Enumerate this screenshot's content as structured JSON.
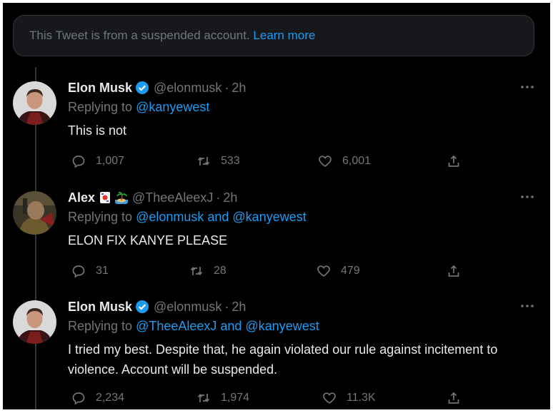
{
  "notice": {
    "text": "This Tweet is from a suspended account. ",
    "link": "Learn more"
  },
  "tweets": [
    {
      "name": "Elon Musk",
      "verified": true,
      "handle": "@elonmusk",
      "time": "2h",
      "replying_label": "Replying to ",
      "replying_to": "@kanyewest",
      "text": "This is not",
      "replies": "1,007",
      "retweets": "533",
      "likes": "6,001"
    },
    {
      "name": "Alex",
      "emojis": [
        "joker-card-emoji",
        "desert-island-emoji"
      ],
      "handle": "@TheeAleexJ",
      "time": "2h",
      "replying_label": "Replying to ",
      "replying_to": "@elonmusk and @kanyewest",
      "text": "ELON FIX KANYE PLEASE",
      "replies": "31",
      "retweets": "28",
      "likes": "479"
    },
    {
      "name": "Elon Musk",
      "verified": true,
      "handle": "@elonmusk",
      "time": "2h",
      "replying_label": "Replying to ",
      "replying_to": "@TheeAleexJ and @kanyewest",
      "text": "I tried my best. Despite that, he again violated our rule against incitement to violence. Account will be suspended.",
      "replies": "2,234",
      "retweets": "1,974",
      "likes": "11.3K"
    }
  ],
  "colors": {
    "background": "#000000",
    "text": "#e7e9ea",
    "muted": "#71767b",
    "link": "#1d9bf0",
    "verified": "#1d9bf0"
  }
}
